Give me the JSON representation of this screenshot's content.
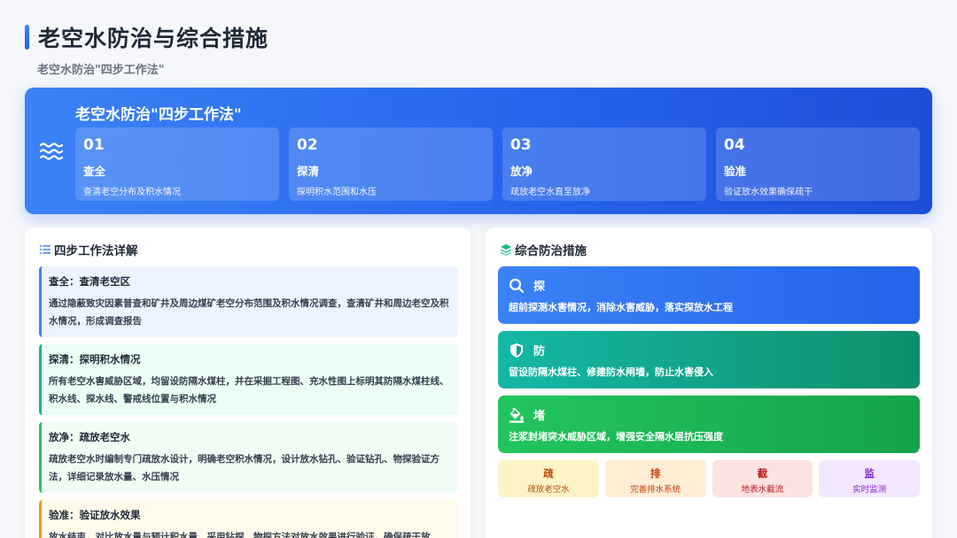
{
  "header": {
    "title": "老空水防治与综合措施",
    "subtitle": "老空水防治\"四步工作法\""
  },
  "hero": {
    "icon": "water-waves-icon",
    "title": "老空水防治\"四步工作法\"",
    "steps": [
      {
        "num": "01",
        "name": "查全",
        "desc": "查清老空分布及积水情况"
      },
      {
        "num": "02",
        "name": "探清",
        "desc": "探明积水范围和水压"
      },
      {
        "num": "03",
        "name": "放净",
        "desc": "疏放老空水直至放净"
      },
      {
        "num": "04",
        "name": "验准",
        "desc": "验证放水效果确保疏干"
      }
    ]
  },
  "details": {
    "heading": "四步工作法详解",
    "icon": "list-icon",
    "items": [
      {
        "head": "查全：查清老空区",
        "body": "通过隐蔽致灾因素普查和矿井及周边煤矿老空分布范围及积水情况调查，查清矿井和周边老空及积水情况，形成调查报告"
      },
      {
        "head": "探清：探明积水情况",
        "body": "所有老空水害威胁区域，均留设防隔水煤柱，并在采掘工程图、充水性图上标明其防隔水煤柱线、积水线、探水线、警戒线位置与积水情况"
      },
      {
        "head": "放净：疏放老空水",
        "body": "疏放老空水时编制专门疏放水设计，明确老空积水情况，设计放水钻孔、验证钻孔、物探验证方法，详细记录放水量、水压情况"
      },
      {
        "head": "验准：验证放水效果",
        "body": "放水结束，对比放水量与预计积水量，采用钻探、物探方法对放水效果进行验证，确保疏干放"
      }
    ]
  },
  "measures": {
    "heading": "综合防治措施",
    "icon": "layers-icon",
    "items": [
      {
        "title": "探",
        "icon": "search-icon",
        "desc": "超前探测水害情况，消除水害威胁，落实探放水工程"
      },
      {
        "title": "防",
        "icon": "shield-icon",
        "desc": "留设防隔水煤柱、修建防水闸墙，防止水害侵入"
      },
      {
        "title": "堵",
        "icon": "fill-bucket-icon",
        "desc": "注浆封堵突水威胁区域，增强安全隔水层抗压强度"
      }
    ],
    "chips": [
      {
        "title": "疏",
        "sub": "疏放老空水"
      },
      {
        "title": "排",
        "sub": "完善排水系统"
      },
      {
        "title": "截",
        "sub": "地表水截流"
      },
      {
        "title": "监",
        "sub": "实时监测"
      }
    ]
  }
}
